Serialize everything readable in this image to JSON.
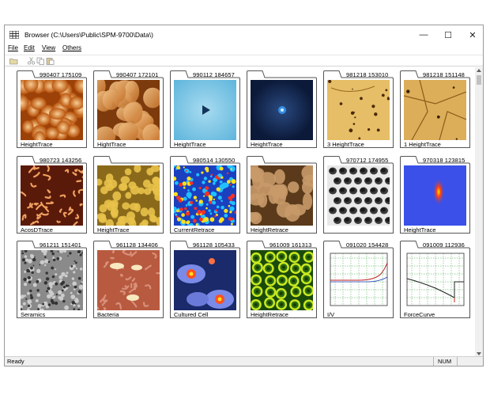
{
  "window": {
    "title": "Browser (C:\\Users\\Public\\SPM-9700\\Data\\)",
    "minimize_glyph": "—",
    "maximize_glyph": "☐",
    "close_glyph": "✕"
  },
  "menu": [
    "File",
    "Edit",
    "View",
    "Others"
  ],
  "toolbar": {
    "icons": [
      "open-folder-icon",
      "cut-icon",
      "copy-icon",
      "paste-icon"
    ]
  },
  "cards": [
    {
      "label": "990407 175109",
      "caption": "HeightTrace",
      "thumb": "orange-grains"
    },
    {
      "label": "990407 172101",
      "caption": "HightTrace",
      "thumb": "orange-flakes"
    },
    {
      "label": "990112 184657",
      "caption": "HeightTrace",
      "thumb": "cyan-tip"
    },
    {
      "label": "",
      "caption": "HeightTrace",
      "thumb": "navy-tip"
    },
    {
      "label": "981218 153010",
      "caption": "3 HeightTrace",
      "thumb": "tan-spots"
    },
    {
      "label": "981218 151148",
      "caption": "1 HeightTrace",
      "thumb": "tan-cracks"
    },
    {
      "label": "980723 143256",
      "caption": "AcosDTrace",
      "thumb": "maze"
    },
    {
      "label": "",
      "caption": "HeightTrace",
      "thumb": "bumps"
    },
    {
      "label": "980514 130550",
      "caption": "CurrentRetrace",
      "thumb": "rainbow-noise"
    },
    {
      "label": "",
      "caption": "HeightRetrace",
      "thumb": "brown-blobs"
    },
    {
      "label": "970712 174955",
      "caption": "",
      "thumb": "honeycomb"
    },
    {
      "label": "970318 123815",
      "caption": "HeightTrace",
      "thumb": "blue-red-streak"
    },
    {
      "label": "961211 151401",
      "caption": "Seramics",
      "thumb": "gray-grain"
    },
    {
      "label": "961128 134406",
      "caption": "Bacteria",
      "thumb": "bacteria"
    },
    {
      "label": "961128 105433",
      "caption": "Cultured Cell",
      "thumb": "cells"
    },
    {
      "label": "961009 161313",
      "caption": "HeightRetrace",
      "thumb": "green-cells"
    },
    {
      "label": "091020 154428",
      "caption": "I/V",
      "thumb": "iv-graph"
    },
    {
      "label": "091009 112936",
      "caption": "ForceCurve",
      "thumb": "force-graph"
    }
  ],
  "statusbar": {
    "status": "Ready",
    "num": "NUM"
  },
  "colors": {
    "window_border": "#9a9a9a",
    "statusbar_bg": "#f0f0f0",
    "card_border": "#555555"
  }
}
